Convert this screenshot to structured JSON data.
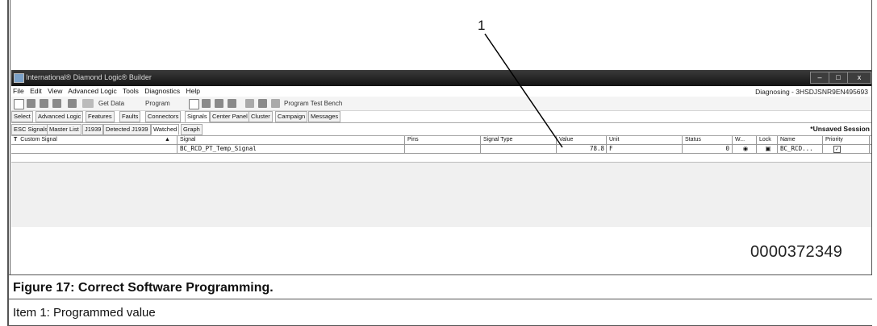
{
  "callout_number": "1",
  "figure_id": "0000372349",
  "caption": "Figure 17: Correct Software Programming.",
  "item_text": "Item 1: Programmed value",
  "app": {
    "title": "International® Diamond Logic® Builder",
    "window_buttons": [
      "–",
      "□",
      "x"
    ],
    "menu": [
      "File",
      "Edit",
      "View",
      "Advanced Logic",
      "Tools",
      "Diagnostics",
      "Help"
    ],
    "diagnosing": "Diagnosing - 3HSDJSNR9EN495693",
    "toolbar": {
      "get_data": "Get Data",
      "program": "Program",
      "program_test_bench": "Program Test Bench"
    },
    "main_tabs": [
      "Select",
      "Advanced Logic",
      "Features",
      "Faults",
      "Connectors",
      "Signals",
      "Center Panel",
      "Cluster",
      "Campaign",
      "Messages"
    ],
    "main_active": "Signals",
    "sub_tabs": [
      "ESC Signals",
      "Master List",
      "J1939",
      "Detected J1939",
      "Watched",
      "Graph"
    ],
    "sub_active": "Watched",
    "unsaved": "*Unsaved Session",
    "columns": [
      "Custom Signal",
      "Signal",
      "Pins",
      "Signal Type",
      "Value",
      "Unit",
      "Status",
      "W...",
      "Lock",
      "Name",
      "Priority"
    ],
    "filter_icon": "T",
    "row": {
      "signal": "BC_RCD_PT_Temp_Signal",
      "pins": "",
      "signal_type": "",
      "value": "78.8",
      "unit": "F",
      "status": "0",
      "name": "BC_RCD...",
      "priority_checked": "✓",
      "watch_icon": "eye-icon",
      "lock_icon": "lock-icon"
    }
  }
}
